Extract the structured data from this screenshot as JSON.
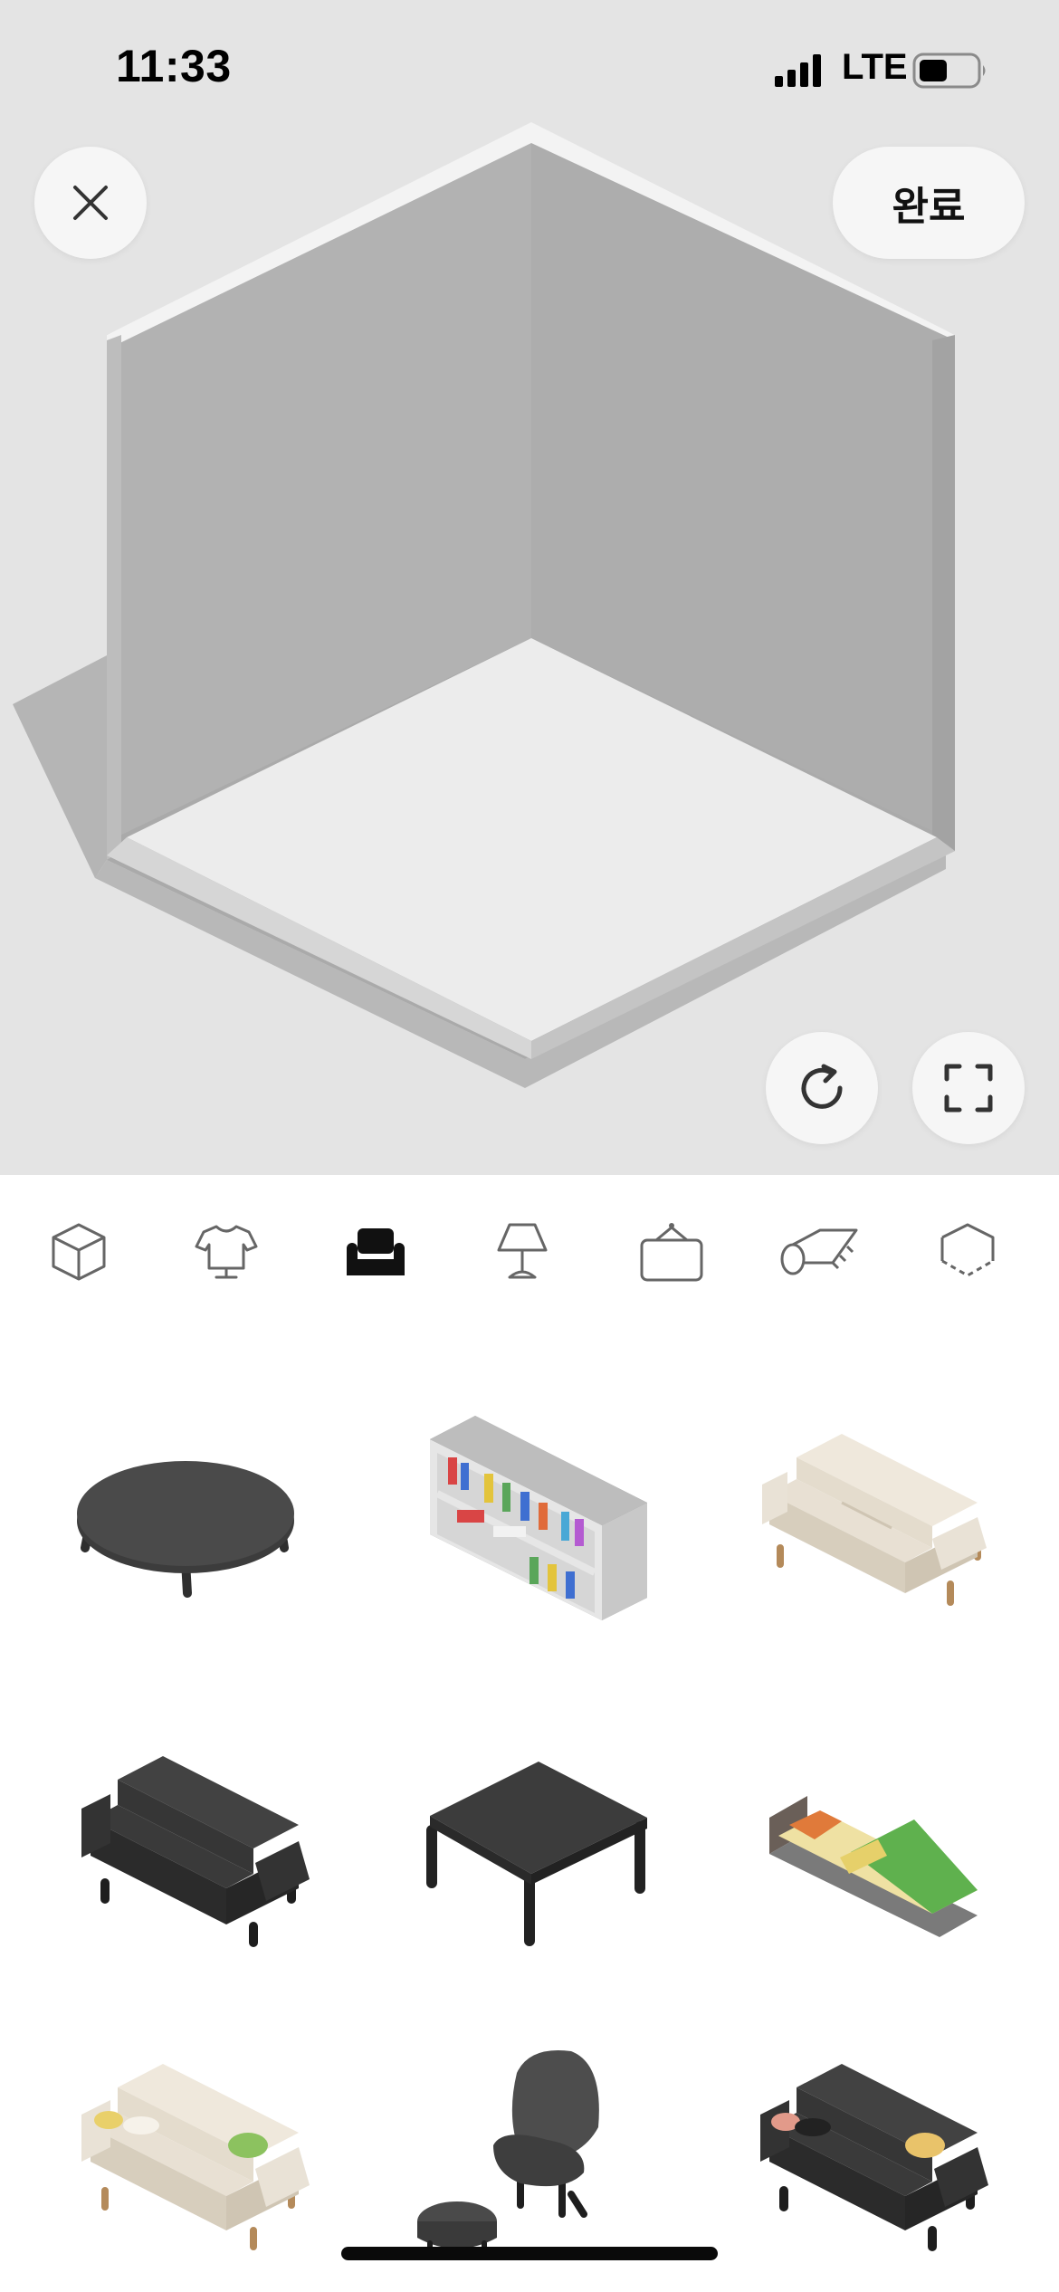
{
  "status_bar": {
    "time": "11:33",
    "network": "LTE"
  },
  "viewer": {
    "done_label": "완료",
    "close_icon": "close-icon",
    "reset_icon": "refresh-icon",
    "fullscreen_icon": "fullscreen-icon"
  },
  "category_tabs": [
    {
      "icon": "cube-icon",
      "selected": false
    },
    {
      "icon": "shirt-on-hanger-icon",
      "selected": false
    },
    {
      "icon": "armchair-icon",
      "selected": true
    },
    {
      "icon": "lamp-icon",
      "selected": false
    },
    {
      "icon": "wall-frame-icon",
      "selected": false
    },
    {
      "icon": "rug-roll-icon",
      "selected": false
    },
    {
      "icon": "floor-tile-icon",
      "selected": false
    }
  ],
  "furniture_items": [
    "oval-coffee-table-dark",
    "bookshelf-white",
    "sofa-cream",
    "sofa-black",
    "table-dark",
    "bed-yellow-green",
    "sofa-cream-with-cushions",
    "armchair-with-ottoman-grey",
    "sofa-black-with-cushions"
  ],
  "colors": {
    "accent": "#111111",
    "room_wall": "#b0b0b0",
    "room_floor": "#ececec",
    "background": "#e4e4e4"
  }
}
